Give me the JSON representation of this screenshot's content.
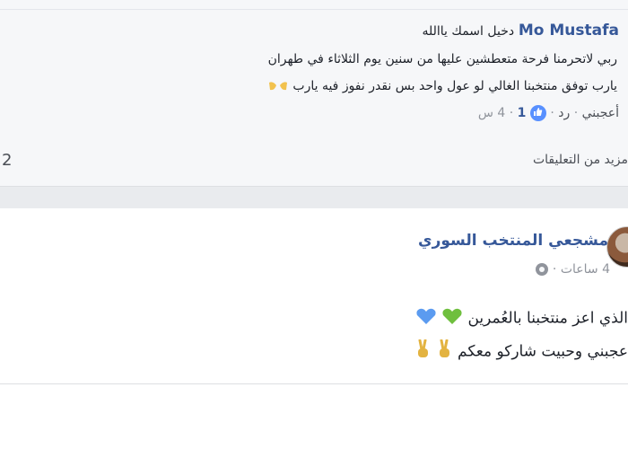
{
  "comment": {
    "author": "Mo Mustafa",
    "text_head": "دخيل اسمك ياالله",
    "line2": "ربي لاتحرمنا فرحة متعطشين عليها من سنين يوم الثلاثاء في طهران",
    "line3": "يارب توفق منتخبنا الغالي لو عول واحد بس نقدر نفوز فيه يارب",
    "like_label": "أعجبني",
    "reply_label": "رد",
    "separator": "·",
    "like_count": "1",
    "time": "4 س",
    "more_comments": "مزيد من التعليقات",
    "side_count": "2"
  },
  "post": {
    "page_name": "مشجعي المنتخب السوري",
    "time": "4 ساعات",
    "separator": "·",
    "line1": "الذي اعز منتخبنا بالعُمرين",
    "line2": "عجبني وحبيت شاركو معكم"
  },
  "colors": {
    "link_blue": "#365899",
    "like_blue": "#5890ff",
    "heart_blue": "#5b9bf0",
    "heart_green": "#6fbf3e",
    "hand_gold": "#e3b341"
  },
  "icons": [
    "praying-hands-icon",
    "like-thumb-icon",
    "globe-icon",
    "green-heart-icon",
    "blue-heart-icon",
    "victory-hand-icon"
  ]
}
